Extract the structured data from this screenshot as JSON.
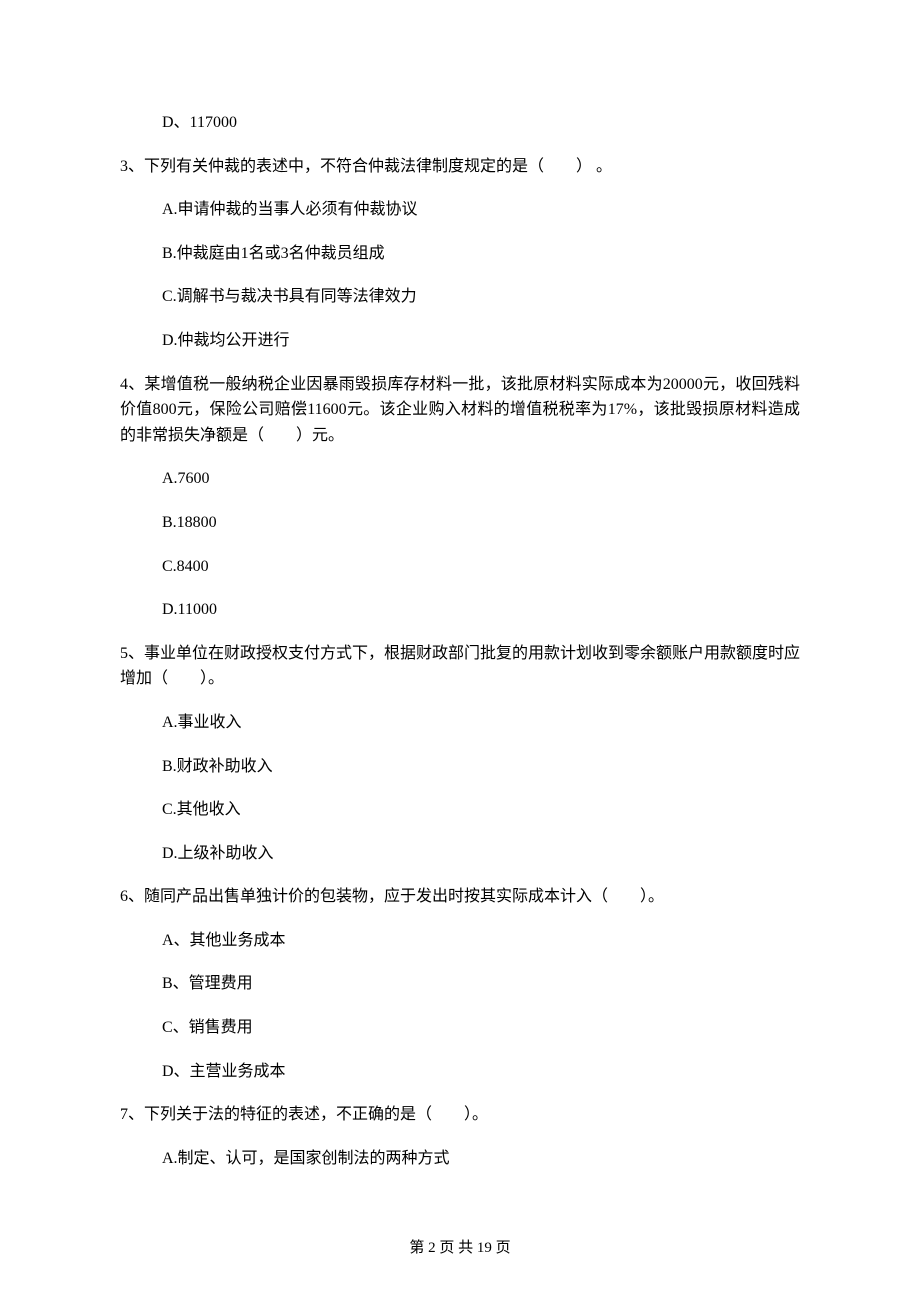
{
  "q2_optD": "D、117000",
  "q3": {
    "stem": "3、下列有关仲裁的表述中，不符合仲裁法律制度规定的是（　　） 。",
    "optA": "A.申请仲裁的当事人必须有仲裁协议",
    "optB": "B.仲裁庭由1名或3名仲裁员组成",
    "optC": "C.调解书与裁决书具有同等法律效力",
    "optD": "D.仲裁均公开进行"
  },
  "q4": {
    "stem": "4、某增值税一般纳税企业因暴雨毁损库存材料一批，该批原材料实际成本为20000元，收回残料价值800元，保险公司赔偿11600元。该企业购入材料的增值税税率为17%，该批毁损原材料造成的非常损失净额是（　　）元。",
    "optA": "A.7600",
    "optB": "B.18800",
    "optC": "C.8400",
    "optD": "D.11000"
  },
  "q5": {
    "stem": "5、事业单位在财政授权支付方式下，根据财政部门批复的用款计划收到零余额账户用款额度时应增加（　　）。",
    "optA": "A.事业收入",
    "optB": "B.财政补助收入",
    "optC": "C.其他收入",
    "optD": "D.上级补助收入"
  },
  "q6": {
    "stem": "6、随同产品出售单独计价的包装物，应于发出时按其实际成本计入（　　）。",
    "optA": "A、其他业务成本",
    "optB": "B、管理费用",
    "optC": "C、销售费用",
    "optD": "D、主营业务成本"
  },
  "q7": {
    "stem": "7、下列关于法的特征的表述，不正确的是（　　）。",
    "optA": "A.制定、认可，是国家创制法的两种方式"
  },
  "footer": "第 2 页 共 19 页"
}
